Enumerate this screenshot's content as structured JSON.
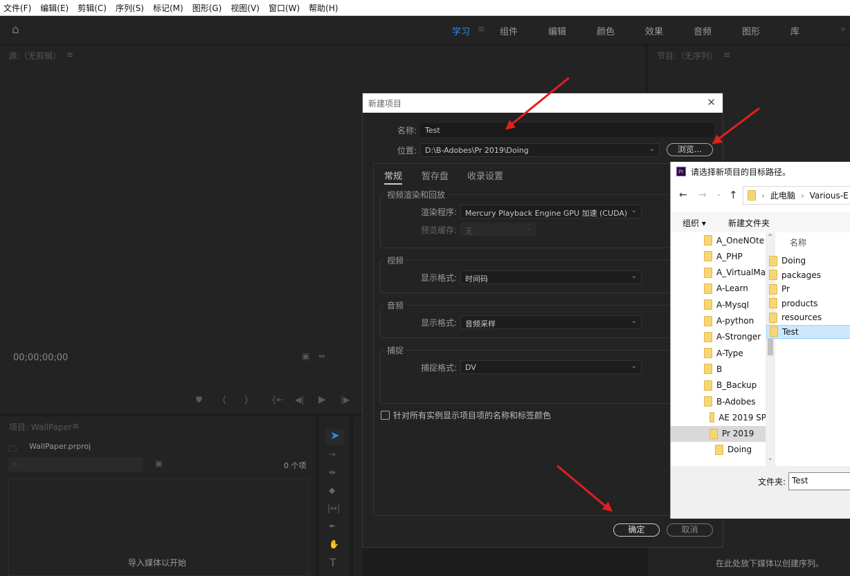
{
  "menubar": [
    "文件(F)",
    "编辑(E)",
    "剪辑(C)",
    "序列(S)",
    "标记(M)",
    "图形(G)",
    "视图(V)",
    "窗口(W)",
    "帮助(H)"
  ],
  "workspaces": {
    "active": "学习",
    "tabs": [
      "学习",
      "组件",
      "编辑",
      "颜色",
      "效果",
      "音频",
      "图形",
      "库"
    ],
    "overflow": "»"
  },
  "source_panel": {
    "title": "源:（无剪辑）",
    "timecode": "00;00;00;00"
  },
  "program_panel": {
    "title": "节目:（无序列）",
    "hint": "在此处放下媒体以创建序列。"
  },
  "project_panel": {
    "title": "项目: WallPaper",
    "file": "WallPaper.prproj",
    "search_placeholder": "",
    "count": "0 个项",
    "empty_hint": "导入媒体以开始"
  },
  "dialog": {
    "title": "新建项目",
    "name_label": "名称:",
    "name_value": "Test",
    "location_label": "位置:",
    "location_value": "D:\\B-Adobes\\Pr 2019\\Doing",
    "browse": "浏览...",
    "tabs": [
      "常规",
      "暂存盘",
      "收录设置"
    ],
    "video_render": {
      "title": "视频渲染和回放",
      "renderer_label": "渲染程序:",
      "renderer_value": "Mercury Playback Engine GPU 加速 (CUDA)",
      "preview_label": "预览缓存:",
      "preview_value": "无"
    },
    "video": {
      "title": "视频",
      "format_label": "显示格式:",
      "format_value": "时间码"
    },
    "audio": {
      "title": "音频",
      "format_label": "显示格式:",
      "format_value": "音频采样"
    },
    "capture": {
      "title": "捕捉",
      "format_label": "捕捉格式:",
      "format_value": "DV"
    },
    "checkbox_label": "针对所有实例显示项目项的名称和标签颜色",
    "checkbox_checked": false,
    "ok": "确定",
    "cancel": "取消"
  },
  "chooser": {
    "app_badge": "Pr",
    "title": "请选择新项目的目标路径。",
    "breadcrumb": [
      "此电脑",
      "Various-E"
    ],
    "organize": "组织 ▾",
    "new_folder": "新建文件夹",
    "tree": [
      "A_OneNOte",
      "A_PHP",
      "A_VirtualMa",
      "A-Learn",
      "A-Mysql",
      "A-python",
      "A-Stronger",
      "A-Type",
      "B",
      "B_Backup",
      "B-Adobes",
      "AE 2019 SP",
      "Pr 2019",
      "Doing"
    ],
    "tree_selected": "Pr 2019",
    "column_header": "名称",
    "files": [
      "Doing",
      "packages",
      "Pr",
      "products",
      "resources",
      "Test"
    ],
    "file_selected": "Test",
    "folder_label": "文件夹:",
    "folder_value": "Test"
  },
  "colors": {
    "accent": "#2d8ceb",
    "arrow": "#e02020",
    "bg": "#232323"
  }
}
